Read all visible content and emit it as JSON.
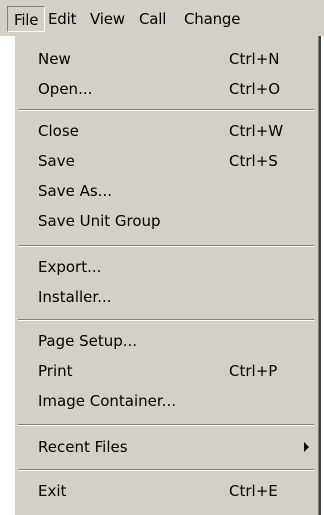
{
  "menubar": {
    "items": [
      {
        "label": "File"
      },
      {
        "label": "Edit"
      },
      {
        "label": "View"
      },
      {
        "label": "Call"
      },
      {
        "label": "Change"
      }
    ]
  },
  "file_menu": {
    "new": {
      "label": "New",
      "shortcut": "Ctrl+N"
    },
    "open": {
      "label": "Open...",
      "shortcut": "Ctrl+O"
    },
    "close": {
      "label": "Close",
      "shortcut": "Ctrl+W"
    },
    "save": {
      "label": "Save",
      "shortcut": "Ctrl+S"
    },
    "save_as": {
      "label": "Save As..."
    },
    "save_unit_group": {
      "label": "Save Unit Group"
    },
    "export": {
      "label": "Export..."
    },
    "installer": {
      "label": "Installer..."
    },
    "page_setup": {
      "label": "Page Setup..."
    },
    "print": {
      "label": "Print",
      "shortcut": "Ctrl+P"
    },
    "image_container": {
      "label": "Image Container..."
    },
    "recent_files": {
      "label": "Recent Files",
      "submenu_icon": "submenu-arrow-icon"
    },
    "exit": {
      "label": "Exit",
      "shortcut": "Ctrl+E"
    }
  }
}
